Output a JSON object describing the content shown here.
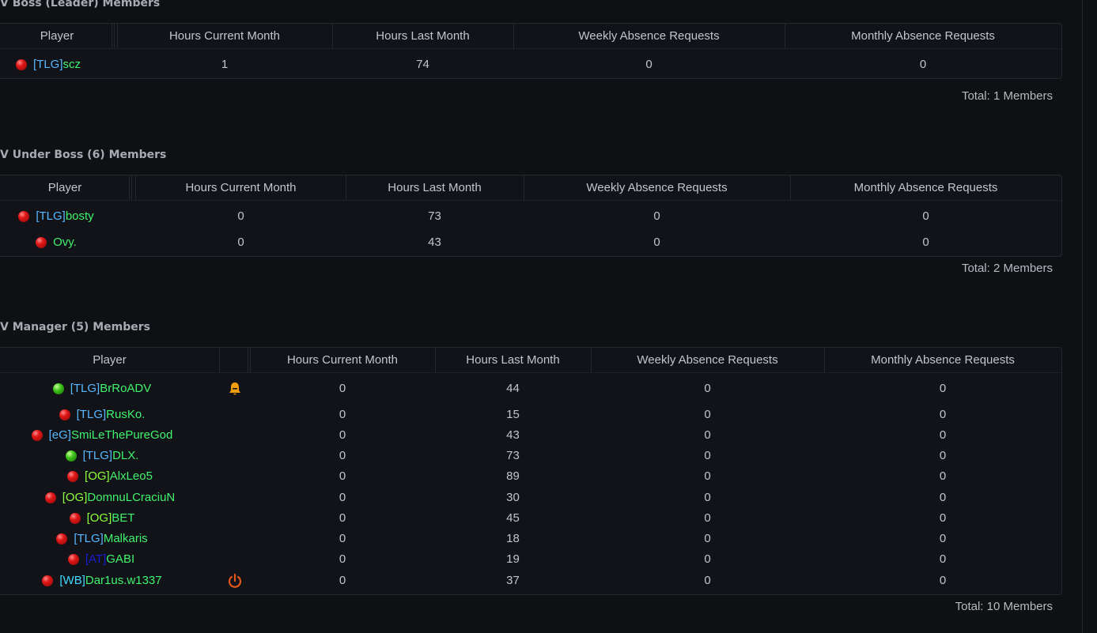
{
  "sections": [
    {
      "title": "V Boss (Leader) Members",
      "headers": [
        "Player",
        "Hours Current Month",
        "Hours Last Month",
        "Weekly Absence Requests",
        "Monthly Absence Requests"
      ],
      "rows": [
        {
          "status": "offline",
          "tag": "[TLG]",
          "name": "scz",
          "hours_current": "1",
          "hours_last": "74",
          "weekly": "0",
          "monthly": "0"
        }
      ],
      "total": "Total: 1 Members"
    },
    {
      "title": "V Under Boss (6) Members",
      "headers": [
        "Player",
        "Hours Current Month",
        "Hours Last Month",
        "Weekly Absence Requests",
        "Monthly Absence Requests"
      ],
      "rows": [
        {
          "status": "offline",
          "tag": "[TLG]",
          "name": "bosty",
          "hours_current": "0",
          "hours_last": "73",
          "weekly": "0",
          "monthly": "0"
        },
        {
          "status": "offline",
          "tag": "",
          "name": "Ovy.",
          "hours_current": "0",
          "hours_last": "43",
          "weekly": "0",
          "monthly": "0"
        }
      ],
      "total": "Total: 2 Members"
    },
    {
      "title": "V Manager (5) Members",
      "headers": [
        "Player",
        "",
        "Hours Current Month",
        "Hours Last Month",
        "Weekly Absence Requests",
        "Monthly Absence Requests"
      ],
      "rows": [
        {
          "status": "online",
          "tag": "[TLG]",
          "name": "BrRoADV",
          "icon": "bell-icon",
          "hours_current": "0",
          "hours_last": "44",
          "weekly": "0",
          "monthly": "0"
        },
        {
          "status": "offline",
          "tag": "[TLG]",
          "name": "RusKo.",
          "icon": "",
          "hours_current": "0",
          "hours_last": "15",
          "weekly": "0",
          "monthly": "0"
        },
        {
          "status": "offline",
          "tag": "[eG]",
          "name": "SmiLeThePureGod",
          "icon": "",
          "hours_current": "0",
          "hours_last": "43",
          "weekly": "0",
          "monthly": "0"
        },
        {
          "status": "online",
          "tag": "[TLG]",
          "name": "DLX.",
          "icon": "",
          "hours_current": "0",
          "hours_last": "73",
          "weekly": "0",
          "monthly": "0"
        },
        {
          "status": "offline",
          "tag": "[OG]",
          "name": "AlxLeo5",
          "icon": "",
          "hours_current": "0",
          "hours_last": "89",
          "weekly": "0",
          "monthly": "0"
        },
        {
          "status": "offline",
          "tag": "[OG]",
          "name": "DomnuLCraciuN",
          "icon": "",
          "hours_current": "0",
          "hours_last": "30",
          "weekly": "0",
          "monthly": "0"
        },
        {
          "status": "offline",
          "tag": "[OG]",
          "name": "BET",
          "icon": "",
          "hours_current": "0",
          "hours_last": "45",
          "weekly": "0",
          "monthly": "0"
        },
        {
          "status": "offline",
          "tag": "[TLG]",
          "name": "Malkaris",
          "icon": "",
          "hours_current": "0",
          "hours_last": "18",
          "weekly": "0",
          "monthly": "0"
        },
        {
          "status": "offline",
          "tag": "[AT]",
          "name": "GABI",
          "icon": "",
          "hours_current": "0",
          "hours_last": "19",
          "weekly": "0",
          "monthly": "0"
        },
        {
          "status": "offline",
          "tag": "[WB]",
          "name": "Dar1us.w1337",
          "icon": "power-icon",
          "hours_current": "0",
          "hours_last": "37",
          "weekly": "0",
          "monthly": "0"
        }
      ],
      "total": "Total: 10 Members"
    }
  ],
  "colors": {
    "tag": "#58b7ff",
    "tag_dark": "#1a1ad6",
    "name": "#3ff36d",
    "og_tag": "#8dff3a",
    "online": "#3bc218",
    "offline": "#e01818",
    "bell": "#f59e0b",
    "power": "#e2561a"
  }
}
